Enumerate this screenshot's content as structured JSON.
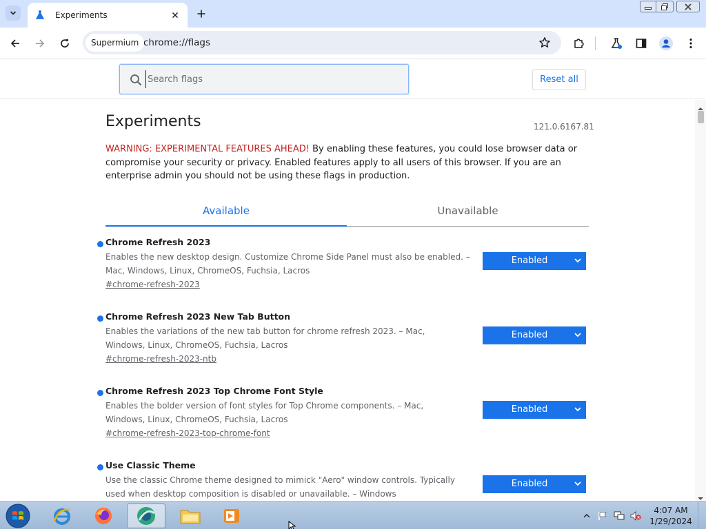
{
  "browser": {
    "tab": {
      "title": "Experiments"
    },
    "address": {
      "chip": "Supermium",
      "url": "chrome://flags"
    }
  },
  "flags": {
    "search_placeholder": "Search flags",
    "reset_label": "Reset all",
    "title": "Experiments",
    "version": "121.0.6167.81",
    "warning_strong": "WARNING: EXPERIMENTAL FEATURES AHEAD!",
    "warning_rest": " By enabling these features, you could lose browser data or compromise your security or privacy. Enabled features apply to all users of this browser. If you are an enterprise admin you should not be using these flags in production.",
    "tabs": {
      "available": "Available",
      "unavailable": "Unavailable"
    },
    "experiments": [
      {
        "name": "Chrome Refresh 2023",
        "description": "Enables the new desktop design. Customize Chrome Side Panel must also be enabled. – Mac, Windows, Linux, ChromeOS, Fuchsia, Lacros",
        "link": "#chrome-refresh-2023",
        "state": "Enabled"
      },
      {
        "name": "Chrome Refresh 2023 New Tab Button",
        "description": "Enables the variations of the new tab button for chrome refresh 2023. – Mac, Windows, Linux, ChromeOS, Fuchsia, Lacros",
        "link": "#chrome-refresh-2023-ntb",
        "state": "Enabled"
      },
      {
        "name": "Chrome Refresh 2023 Top Chrome Font Style",
        "description": "Enables the bolder version of font styles for Top Chrome components. – Mac, Windows, Linux, ChromeOS, Fuchsia, Lacros",
        "link": "#chrome-refresh-2023-top-chrome-font",
        "state": "Enabled"
      },
      {
        "name": "Use Classic Theme",
        "description": "Use the classic Chrome theme designed to mimick \"Aero\" window controls. Typically used when desktop composition is disabled or unavailable. – Windows",
        "link": "",
        "state": "Enabled"
      }
    ]
  },
  "taskbar": {
    "time": "4:07 AM",
    "date": "1/29/2024"
  },
  "colors": {
    "accent": "#1a73e8",
    "warning": "#c5221f",
    "tabstrip": "#d3e3fd",
    "omnibox": "#e9eef6",
    "taskbar": "#b8cde4"
  }
}
